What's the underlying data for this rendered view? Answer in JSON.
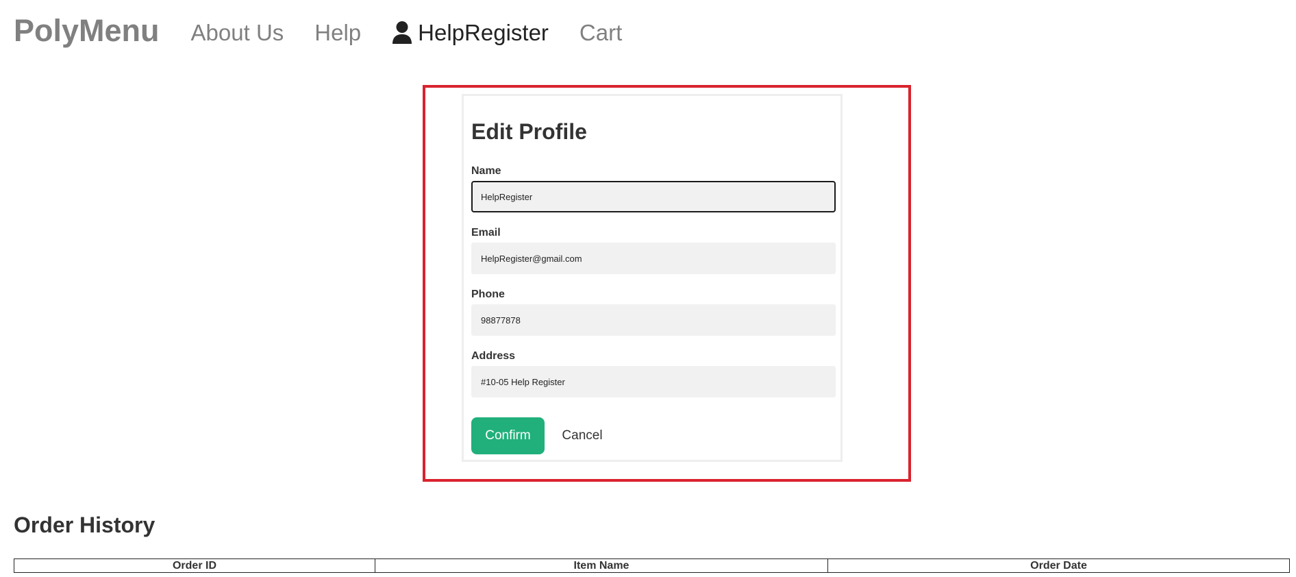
{
  "nav": {
    "brand": "PolyMenu",
    "links": [
      {
        "label": "About Us"
      },
      {
        "label": "Help"
      },
      {
        "label": "HelpRegister",
        "icon": "user-icon"
      },
      {
        "label": "Cart"
      }
    ]
  },
  "form": {
    "title": "Edit Profile",
    "fields": {
      "name": {
        "label": "Name",
        "value": "HelpRegister"
      },
      "email": {
        "label": "Email",
        "value": "HelpRegister@gmail.com"
      },
      "phone": {
        "label": "Phone",
        "value": "98877878"
      },
      "address": {
        "label": "Address",
        "value": "#10-05 Help Register"
      }
    },
    "confirm_label": "Confirm",
    "cancel_label": "Cancel"
  },
  "order_history": {
    "title": "Order History",
    "columns": [
      "Order ID",
      "Item Name",
      "Order Date"
    ]
  },
  "colors": {
    "confirm_button": "#21b07b",
    "highlight_frame": "#d9232e",
    "nav_inactive": "#808080",
    "input_background": "#f1f1f1"
  }
}
